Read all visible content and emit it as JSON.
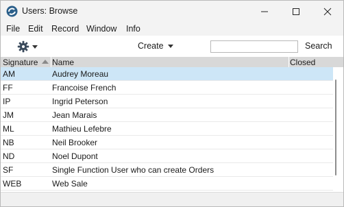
{
  "window": {
    "title": "Users: Browse",
    "controls": [
      "minimize-icon",
      "maximize-icon",
      "close-icon"
    ]
  },
  "menu": [
    "File",
    "Edit",
    "Record",
    "Window",
    "Info"
  ],
  "toolbar": {
    "gear_icon": "gear-icon",
    "create_label": "Create",
    "search_value": "",
    "search_label": "Search"
  },
  "table": {
    "columns": [
      "Signature",
      "Name",
      "Closed"
    ],
    "sort": "Signature ascending",
    "rows": [
      {
        "signature": "AM",
        "name": "Audrey Moreau",
        "selected": true
      },
      {
        "signature": "FF",
        "name": "Francoise French"
      },
      {
        "signature": "IP",
        "name": "Ingrid Peterson"
      },
      {
        "signature": "JM",
        "name": "Jean Marais"
      },
      {
        "signature": "ML",
        "name": "Mathieu Lefebre"
      },
      {
        "signature": "NB",
        "name": "Neil Brooker"
      },
      {
        "signature": "ND",
        "name": "Noel Dupont"
      },
      {
        "signature": "SF",
        "name": "Single Function User who can create Orders"
      },
      {
        "signature": "WEB",
        "name": "Web Sale"
      }
    ]
  },
  "colors": {
    "selection": "#cde6f7",
    "header": "#d8d8d8",
    "chrome": "#f3f3f3",
    "app_icon": "#2b5f8a"
  }
}
